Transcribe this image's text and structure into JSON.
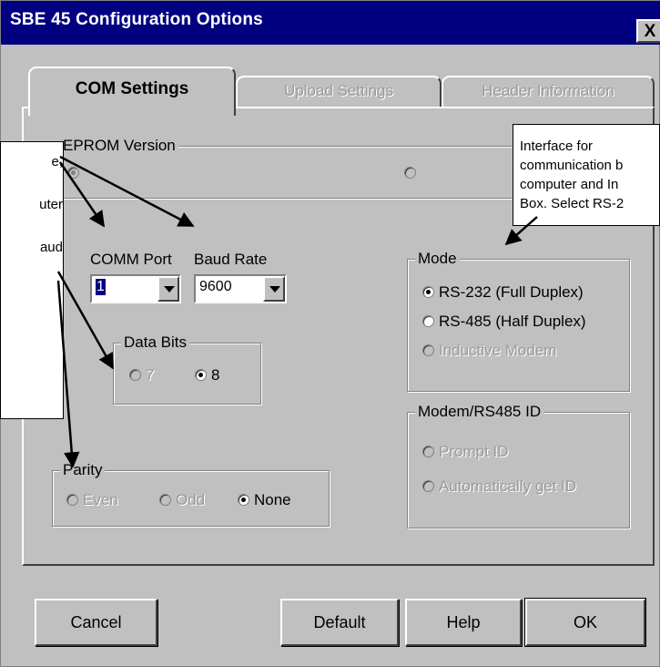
{
  "window": {
    "title": "SBE 45 Configuration Options",
    "close_glyph": "X"
  },
  "tabs": [
    {
      "label": "COM Settings",
      "active": true
    },
    {
      "label": "Upload Settings",
      "active": false
    },
    {
      "label": "Header Information",
      "active": false
    }
  ],
  "eprom": {
    "legend": "EPROM Version",
    "options": [
      {
        "label": "",
        "selected": true,
        "enabled": false
      },
      {
        "label": "",
        "selected": false,
        "enabled": false
      }
    ]
  },
  "comm_port": {
    "label": "COMM Port",
    "value": "1"
  },
  "baud_rate": {
    "label": "Baud Rate",
    "value": "9600"
  },
  "data_bits": {
    "legend": "Data Bits",
    "options": [
      {
        "label": "7",
        "selected": false,
        "enabled": false
      },
      {
        "label": "8",
        "selected": true,
        "enabled": true
      }
    ]
  },
  "parity": {
    "legend": "Parity",
    "options": [
      {
        "label": "Even",
        "selected": false,
        "enabled": false
      },
      {
        "label": "Odd",
        "selected": false,
        "enabled": false
      },
      {
        "label": "None",
        "selected": true,
        "enabled": true
      }
    ]
  },
  "mode": {
    "legend": "Mode",
    "options": [
      {
        "label": "RS-232 (Full Duplex)",
        "selected": true,
        "enabled": true
      },
      {
        "label": "RS-485 (Half Duplex)",
        "selected": false,
        "enabled": true
      },
      {
        "label": "Inductive Modem",
        "selected": false,
        "enabled": false
      }
    ]
  },
  "modem_id": {
    "legend": "Modem/RS485 ID",
    "options": [
      {
        "label": "Prompt ID",
        "selected": false,
        "enabled": false
      },
      {
        "label": "Automatically get ID",
        "selected": false,
        "enabled": false
      }
    ]
  },
  "buttons": {
    "cancel": "Cancel",
    "default": "Default",
    "help": "Help",
    "ok": "OK"
  },
  "annotations": {
    "left_note": [
      "e,",
      "",
      "uter",
      "",
      "aud"
    ],
    "right_note": [
      "Interface for",
      "communication b",
      "computer and In",
      "Box. Select RS-2"
    ]
  },
  "colors": {
    "title_bar": "#000080",
    "dialog_face": "#c0c0c0",
    "disabled_text": "#9a9a9a",
    "selection": "#000080"
  }
}
